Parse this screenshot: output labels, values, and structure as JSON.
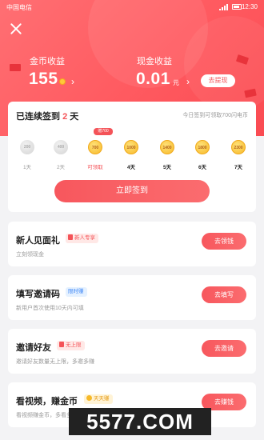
{
  "status_bar": {
    "carrier": "中国电信",
    "time": "12:30"
  },
  "hero": {
    "coin_label": "金币收益",
    "coin_value": "155",
    "cash_label": "现金收益",
    "cash_value": "0.01",
    "cash_unit": "元",
    "withdraw_label": "去提现"
  },
  "signin": {
    "title_prefix": "已连续签到 ",
    "streak_days": "2",
    "title_suffix": " 天",
    "hint": "今日签到可领取700闪电币",
    "bonus_tag": "赠700",
    "coins": [
      {
        "amount": "200",
        "day": "1天",
        "state": "claimed"
      },
      {
        "amount": "400",
        "day": "2天",
        "state": "claimed"
      },
      {
        "amount": "700",
        "day": "可领取",
        "state": "available"
      },
      {
        "amount": "1000",
        "day": "4天",
        "state": "future"
      },
      {
        "amount": "1400",
        "day": "5天",
        "state": "future"
      },
      {
        "amount": "1800",
        "day": "6天",
        "state": "future"
      },
      {
        "amount": "2300",
        "day": "7天",
        "state": "future"
      }
    ],
    "button_label": "立即签到"
  },
  "tasks": [
    {
      "name": "新人见面礼",
      "badge": "新人专享",
      "badge_style": "red",
      "desc": "立刻领现金",
      "button": "去领钱"
    },
    {
      "name": "填写邀请码",
      "badge": "限时赚",
      "badge_style": "blue",
      "desc": "新用户首次使用10天内可填",
      "button": "去填写"
    },
    {
      "name": "邀请好友",
      "badge": "无上限",
      "badge_style": "red",
      "desc": "邀请好友数量无上限，多邀多赚",
      "button": "去邀请"
    },
    {
      "name": "看视频，赚金币",
      "badge": "天天赚",
      "badge_style": "gold",
      "desc": "看视频赚金币，多看多赚",
      "button": "去赚钱"
    }
  ],
  "watermark": "5577.COM",
  "colors": {
    "accent": "#f45358",
    "hero": "#ff5a60",
    "gold": "#f7b928"
  }
}
